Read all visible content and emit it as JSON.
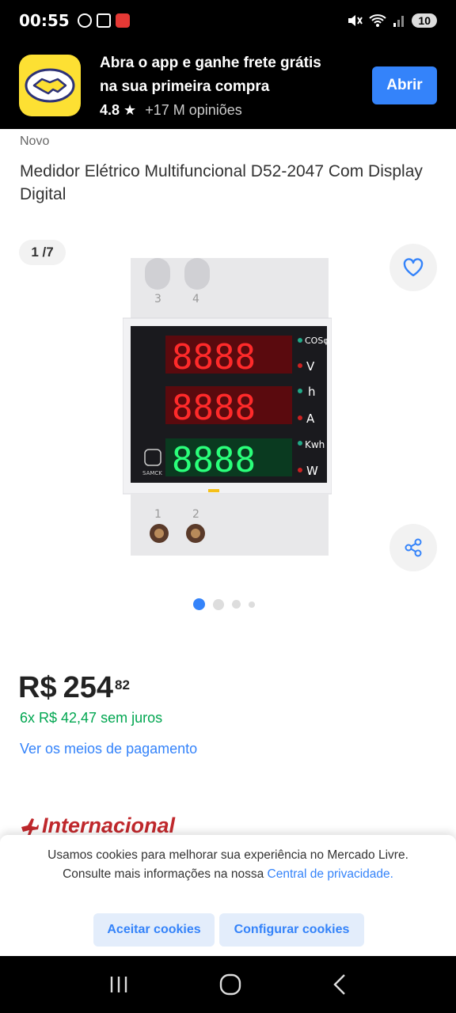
{
  "status": {
    "time": "00:55",
    "battery": "10"
  },
  "banner": {
    "title_line1": "Abra o app e ganhe frete grátis",
    "title_line2": "na sua primeira compra",
    "rating": "4.8",
    "reviews": "+17 M opiniões",
    "open_label": "Abrir"
  },
  "product": {
    "condition": "Novo",
    "title": "Medidor Elétrico Multifuncional D52-2047 Com Display Digital",
    "gallery_counter": "1 /7",
    "image_panel": {
      "terminals_top": [
        "3",
        "4"
      ],
      "terminals_bottom": [
        "1",
        "2"
      ],
      "labels": [
        "COSφ",
        "V",
        "h",
        "A",
        "Kwh",
        "W"
      ],
      "brand": "SAMCK",
      "display_rows": [
        "8888",
        "8888",
        "8888"
      ]
    },
    "gallery_dots": 4
  },
  "price": {
    "currency": "R$",
    "amount": "254",
    "cents": "82",
    "installments": "6x R$ 42,47 sem juros",
    "payment_link": "Ver os meios de pagamento"
  },
  "international": {
    "label": "Internacional"
  },
  "cookies": {
    "text": "Usamos cookies para melhorar sua experiência no Mercado Livre. Consulte mais informações na nossa",
    "link": "Central de privacidade",
    "link_suffix": ".",
    "accept_label": "Aceitar cookies",
    "configure_label": "Configurar cookies"
  },
  "colors": {
    "accent": "#3483fa",
    "installments_green": "#00a650",
    "international_red": "#c0282c",
    "logo_yellow": "#fde033"
  }
}
